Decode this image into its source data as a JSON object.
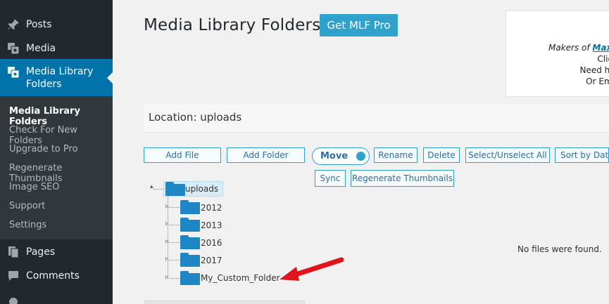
{
  "sidebar": {
    "menu": [
      {
        "label": "Posts",
        "icon": "pin-icon"
      },
      {
        "label": "Media",
        "icon": "media-icon"
      },
      {
        "label": "Media Library Folders",
        "icon": "media-folder-icon"
      },
      {
        "label": "Pages",
        "icon": "pages-icon"
      },
      {
        "label": "Comments",
        "icon": "comments-icon"
      }
    ],
    "submenu": [
      "Media Library Folders",
      "Check For New Folders",
      "Upgrade to Pro",
      "Regenerate Thumbnails",
      "Image SEO",
      "Support",
      "Settings"
    ]
  },
  "header": {
    "title": "Media Library Folders",
    "pro_button": "Get MLF Pro"
  },
  "info_box": {
    "makers_prefix": "Makers of ",
    "makers_link": "MaxB",
    "line2": "Click",
    "line3": "Need hel",
    "line4": "Or Ema"
  },
  "location": {
    "text": "Location: uploads"
  },
  "toolbar": {
    "add_file": "Add File",
    "add_folder": "Add Folder",
    "move": "Move",
    "rename": "Rename",
    "delete": "Delete",
    "select_unselect": "Select/Unselect All",
    "sort_by": "Sort by Date",
    "sync": "Sync",
    "regenerate": "Regenerate Thumbnails"
  },
  "tree": {
    "root": "uploads",
    "children": [
      "2012",
      "2013",
      "2016",
      "2017",
      "My_Custom_Folder"
    ]
  },
  "files": {
    "empty_message": "No files were found."
  },
  "colors": {
    "sidebar_bg": "#23282d",
    "submenu_bg": "#32373c",
    "accent": "#0073aa",
    "button_blue": "#2ea2cc",
    "folder_blue": "#1e86c5",
    "arrow_red": "#e0141a"
  }
}
